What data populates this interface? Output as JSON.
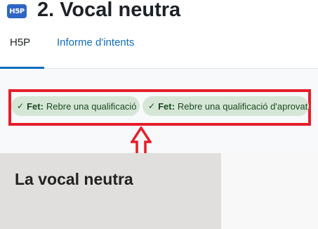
{
  "header": {
    "badge": "H5P",
    "title": "2. Vocal neutra"
  },
  "tabs": [
    {
      "label": "H5P",
      "active": true
    },
    {
      "label": "Informe d'intents",
      "active": false
    }
  ],
  "completion": {
    "items": [
      {
        "status": "Fet:",
        "text": "Rebre una qualificació"
      },
      {
        "status": "Fet:",
        "text": "Rebre una qualificació d'aprovat"
      }
    ]
  },
  "content": {
    "heading": "La vocal neutra"
  },
  "colors": {
    "accent": "#0f6cbf",
    "badge": "#2f66c2",
    "pill_bg": "#d5e6d6",
    "pill_text": "#1c4a22",
    "annotation_red": "#e61e2b",
    "content_bg": "#e0dfdd"
  },
  "icons": {
    "badge": "h5p-logo-icon",
    "check": "check-icon",
    "annotation": "arrow-up-icon"
  }
}
